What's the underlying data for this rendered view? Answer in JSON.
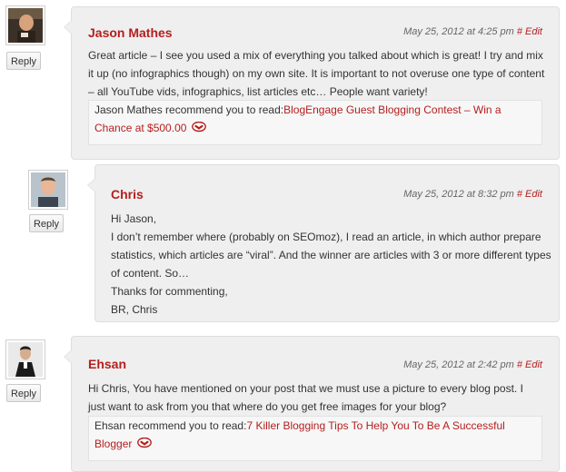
{
  "comments": [
    {
      "author": "Jason Mathes",
      "date": "May 25, 2012 at 4:25 pm",
      "hash": "#",
      "edit": "Edit",
      "reply": "Reply",
      "avatar": "avatar-photo",
      "paragraphs": [
        "Great article – I see you used a mix of everything you talked about which is great! I try and mix it up (no infographics though) on my own site. It is important to not overuse one type of content – all YouTube vids, infographics, list articles etc… People want variety!"
      ],
      "recommend_prefix": "Jason Mathes recommend you to read:",
      "recommend_link": "BlogEngage Guest Blogging Contest – Win a Chance at $500.00"
    },
    {
      "author": "Chris",
      "date": "May 25, 2012 at 8:32 pm",
      "hash": "#",
      "edit": "Edit",
      "reply": "Reply",
      "avatar": "avatar-photo",
      "paragraphs": [
        "Hi Jason,",
        "I don’t remember where (probably on SEOmoz), I read an article, in which author prepare statistics, which articles are “viral”. And the winner are articles with 3 or more different types of content. So…",
        "Thanks for commenting,",
        "BR, Chris"
      ]
    },
    {
      "author": "Ehsan",
      "date": "May 25, 2012 at 2:42 pm",
      "hash": "#",
      "edit": "Edit",
      "reply": "Reply",
      "avatar": "avatar-photo",
      "paragraphs": [
        "Hi Chris, You have mentioned on your post that we must use a picture to every blog post. I just want to ask from you that where do you get free images for your blog?"
      ],
      "recommend_prefix": "Ehsan recommend you to read:",
      "recommend_link": "7 Killer Blogging Tips To Help You To Be A Successful Blogger"
    }
  ],
  "colors": {
    "accent": "#b51e1e",
    "bubble_bg": "#efefef",
    "bubble_border": "#dedede",
    "text": "#333333"
  }
}
